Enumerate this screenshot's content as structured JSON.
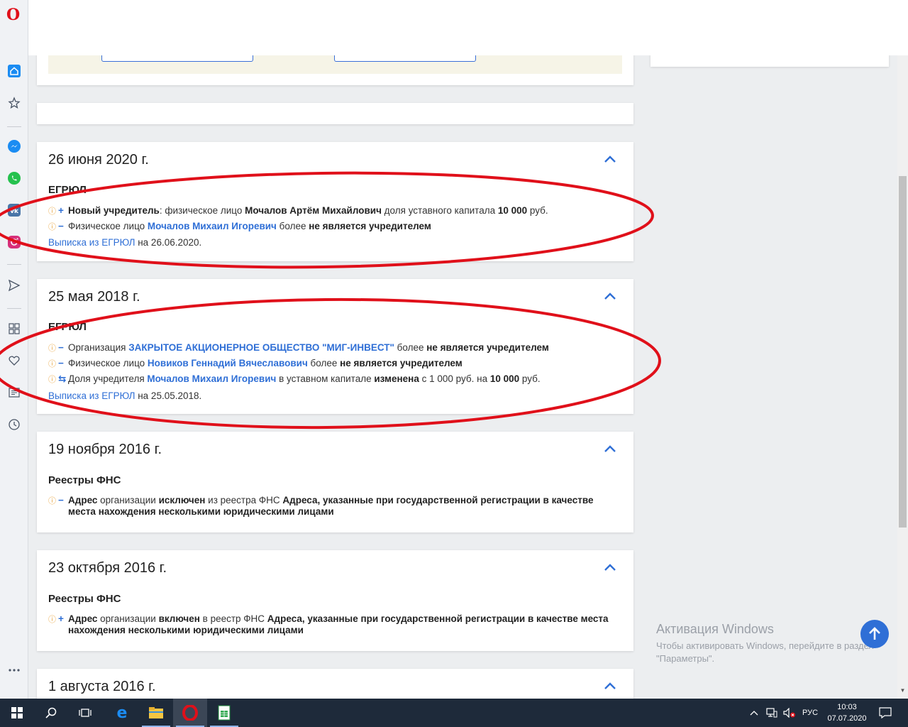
{
  "events": [
    {
      "date": "26 июня 2020 г.",
      "section": "ЕГРЮЛ",
      "lines": [
        {
          "sign": "+",
          "parts": [
            [
              "b",
              "Новый учредитель"
            ],
            [
              "t",
              ": физическое лицо "
            ],
            [
              "b",
              "Мочалов Артём Михайлович"
            ],
            [
              "t",
              " доля уставного капитала "
            ],
            [
              "b",
              "10 000"
            ],
            [
              "t",
              " руб."
            ]
          ]
        },
        {
          "sign": "−",
          "parts": [
            [
              "t",
              "Физическое лицо "
            ],
            [
              "l",
              "Мочалов Михаил Игоревич"
            ],
            [
              "t",
              " более "
            ],
            [
              "b",
              "не является учредителем"
            ]
          ]
        }
      ],
      "source_link": "Выписка из ЕГРЮЛ",
      "source_date": " на 26.06.2020."
    },
    {
      "date": "25 мая 2018 г.",
      "section": "ЕГРЮЛ",
      "lines": [
        {
          "sign": "−",
          "parts": [
            [
              "t",
              "Организация "
            ],
            [
              "l",
              "ЗАКРЫТОЕ АКЦИОНЕРНОЕ ОБЩЕСТВО \"МИГ-ИНВЕСТ\""
            ],
            [
              "t",
              " более "
            ],
            [
              "b",
              "не является учредителем"
            ]
          ]
        },
        {
          "sign": "−",
          "parts": [
            [
              "t",
              "Физическое лицо "
            ],
            [
              "l",
              "Новиков Геннадий Вячеславович"
            ],
            [
              "t",
              " более "
            ],
            [
              "b",
              "не является учредителем"
            ]
          ]
        },
        {
          "sign": "⇆",
          "parts": [
            [
              "t",
              "Доля учредителя "
            ],
            [
              "l",
              "Мочалов Михаил Игоревич"
            ],
            [
              "t",
              " в уставном капитале "
            ],
            [
              "b",
              "изменена"
            ],
            [
              "t",
              " с 1 000 руб. на "
            ],
            [
              "b",
              "10 000"
            ],
            [
              "t",
              " руб."
            ]
          ]
        }
      ],
      "source_link": "Выписка из ЕГРЮЛ",
      "source_date": " на 25.05.2018."
    },
    {
      "date": "19 ноября 2016 г.",
      "section": "Реестры ФНС",
      "lines": [
        {
          "sign": "−",
          "parts": [
            [
              "b",
              "Адрес"
            ],
            [
              "t",
              " организации "
            ],
            [
              "b",
              "исключен"
            ],
            [
              "t",
              " из реестра ФНС "
            ],
            [
              "b",
              "Адреса, указанные при государственной регистрации в качестве места нахождения несколькими юридическими лицами"
            ]
          ]
        }
      ]
    },
    {
      "date": "23 октября 2016 г.",
      "section": "Реестры ФНС",
      "lines": [
        {
          "sign": "+",
          "parts": [
            [
              "b",
              "Адрес"
            ],
            [
              "t",
              " организации "
            ],
            [
              "b",
              "включен"
            ],
            [
              "t",
              " в реестр ФНС "
            ],
            [
              "b",
              "Адреса, указанные при государственной регистрации в качестве места нахождения несколькими юридическими лицами"
            ]
          ]
        }
      ]
    },
    {
      "date": "1 августа 2016 г."
    }
  ],
  "watermark": {
    "title": "Активация Windows",
    "text": "Чтобы активировать Windows, перейдите в раздел \"Параметры\"."
  },
  "taskbar": {
    "lang": "РУС",
    "time": "10:03",
    "date": "07.07.2020"
  },
  "colors": {
    "accent": "#2f6fd6",
    "warning": "#e8a23a",
    "annotation": "#e0101a"
  }
}
